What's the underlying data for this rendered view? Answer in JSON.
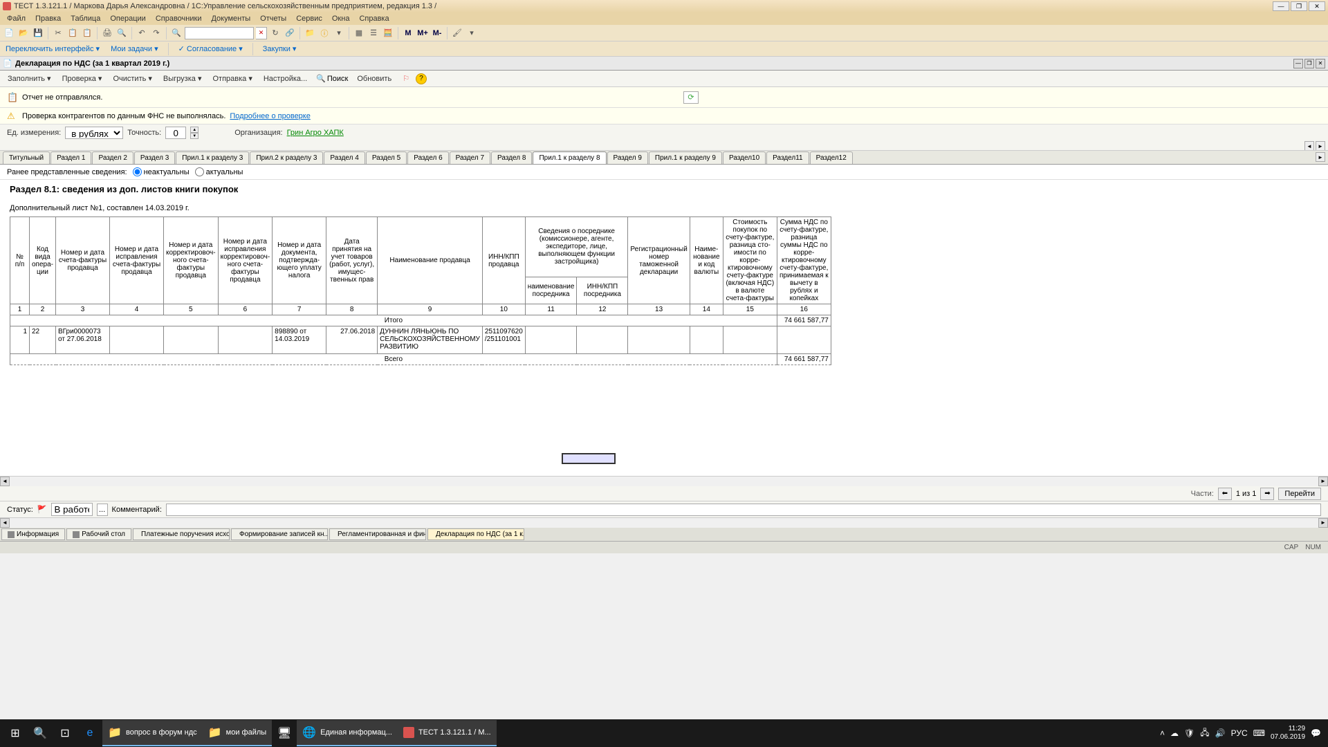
{
  "titlebar": {
    "text": "ТЕСТ 1.3.121.1 / Маркова Дарья Александровна / 1С:Управление сельскохозяйственным предприятием, редакция 1.3 /"
  },
  "menu": {
    "items": [
      "Файл",
      "Правка",
      "Таблица",
      "Операции",
      "Справочники",
      "Документы",
      "Отчеты",
      "Сервис",
      "Окна",
      "Справка"
    ]
  },
  "toolbar1": {
    "m": "M",
    "mplus": "M+",
    "mminus": "M-"
  },
  "toolbar2": {
    "switch": "Переключить интерфейс ▾",
    "tasks": "Мои задачи ▾",
    "agreement": "Согласование ▾",
    "purchases": "Закупки ▾"
  },
  "doc_header": {
    "title": "Декларация по НДС (за 1 квартал 2019 г.)"
  },
  "action_bar": {
    "fill": "Заполнить ▾",
    "check": "Проверка ▾",
    "clear": "Очистить ▾",
    "upload": "Выгрузка ▾",
    "send": "Отправка ▾",
    "settings": "Настройка...",
    "search": "Поиск",
    "refresh": "Обновить",
    "help_q": "?"
  },
  "info1": {
    "text": "Отчет не отправлялся."
  },
  "info2": {
    "text": "Проверка контрагентов по данным ФНС не выполнялась.",
    "link": "Подробнее о проверке"
  },
  "params": {
    "unit_label": "Ед. измерения:",
    "unit_value": "в рублях",
    "precision_label": "Точность:",
    "precision_value": "0",
    "org_label": "Организация:",
    "org_value": "Грин Агро ХАПК"
  },
  "tabs": {
    "items": [
      "Титульный",
      "Раздел 1",
      "Раздел 2",
      "Раздел 3",
      "Прил.1 к разделу 3",
      "Прил.2 к разделу 3",
      "Раздел 4",
      "Раздел 5",
      "Раздел 6",
      "Раздел 7",
      "Раздел 8",
      "Прил.1 к разделу 8",
      "Раздел 9",
      "Прил.1 к разделу 9",
      "Раздел10",
      "Раздел11",
      "Раздел12"
    ],
    "active_index": 11
  },
  "radio": {
    "label": "Ранее представленные сведения:",
    "opt1": "неактуальны",
    "opt2": "актуальны"
  },
  "section": {
    "title": "Раздел 8.1: сведения из доп. листов книги покупок",
    "subtitle": "Дополнительный лист №1, составлен 14.03.2019 г."
  },
  "table": {
    "h_num": "№ п/п",
    "h_op": "Код вида опера-ции",
    "h_3": "Номер и дата счета-фактуры продавца",
    "h_4": "Номер и дата исправления счета-фактуры продавца",
    "h_5": "Номер и дата корректировоч-ного счета-фактуры продавца",
    "h_6": "Номер и дата исправления корректировоч-ного счета-фактуры продавца",
    "h_7": "Номер и дата документа, подтвержда-ющего уплату налога",
    "h_8": "Дата принятия на учет товаров (работ, услуг), имущес-твенных прав",
    "h_9": "Наименование продавца",
    "h_10": "ИНН/КПП продавца",
    "h_11_top": "Сведения о посреднике (комиссионере, агенте, экспедиторе, лице, выполняющем функции застройщика)",
    "h_11": "наименование посредника",
    "h_12": "ИНН/КПП посредника",
    "h_13": "Регистрационный номер таможенной декларации",
    "h_14": "Наиме-нование и код валюты",
    "h_15": "Стоимость покупок по счету-фактуре, разница сто-имости по корре-ктировочному счету-фактуре (включая НДС) в валюте счета-фактуры",
    "h_16": "Сумма НДС по счету-фактуре, разница суммы НДС по корре-ктировочному счету-фактуре, принимаемая к вычету в рублях и копейках",
    "nums": [
      "1",
      "2",
      "3",
      "4",
      "5",
      "6",
      "7",
      "8",
      "9",
      "10",
      "11",
      "12",
      "13",
      "14",
      "15",
      "16"
    ],
    "total1_label": "Итого",
    "total1_value": "74 661 587,77",
    "row": {
      "c1": "1",
      "c2": "22",
      "c3": "ВГри0000073 от 27.06.2018",
      "c7": "898890 от 14.03.2019",
      "c8": "27.06.2018",
      "c9": "ДУННИН ЛЯНЬЮНЬ ПО СЕЛЬСКОХОЗЯЙСТВЕННОМУ РАЗВИТИЮ",
      "c10": "2511097620 /251101001"
    },
    "total2_label": "Всего",
    "total2_value": "74 661 587,77"
  },
  "nav": {
    "parts_label": "Части:",
    "parts_value": "1 из 1",
    "go": "Перейти"
  },
  "status": {
    "label": "Статус:",
    "value": "В работе",
    "comment_label": "Комментарий:"
  },
  "bottom_tabs": {
    "items": [
      "Информация",
      "Рабочий стол",
      "Платежные поручения исхо...",
      "Формирование записей кн...",
      "Регламентированная и фин...",
      "Декларация по НДС (за 1 к..."
    ],
    "active_index": 5
  },
  "statusbar": {
    "cap": "CAP",
    "num": "NUM"
  },
  "taskbar": {
    "items": [
      "вопрос в форум ндс",
      "мои файлы",
      "Единая информац...",
      "ТЕСТ 1.3.121.1 / М..."
    ],
    "lang": "РУС",
    "time": "11:29",
    "date": "07.06.2019"
  }
}
